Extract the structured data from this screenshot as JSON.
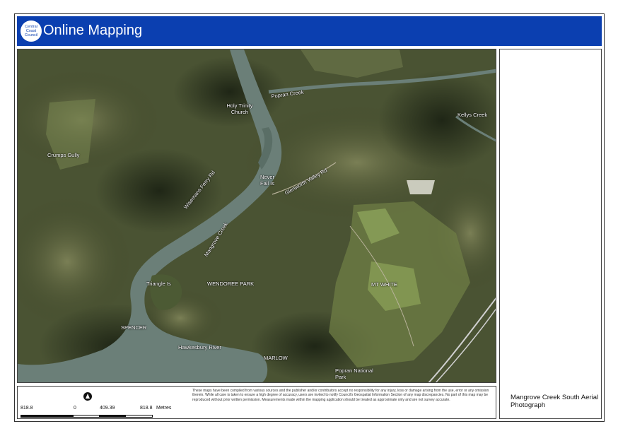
{
  "header": {
    "title": "Online Mapping",
    "logo_text": "Central Coast Council",
    "color": "#0b3fb0"
  },
  "map": {
    "labels": [
      {
        "id": "holy-trinity-church",
        "text": "Holy Trinity Church"
      },
      {
        "id": "popran-creek",
        "text": "Popran Creek"
      },
      {
        "id": "kellys-creek",
        "text": "Kellys Creek"
      },
      {
        "id": "crumps-gully",
        "text": "Crumps Gully"
      },
      {
        "id": "never-fail-is",
        "text": "Never Fail Is"
      },
      {
        "id": "glenworth-valley-rd",
        "text": "Glenworth Valley Rd"
      },
      {
        "id": "wisemans-ferry-rd",
        "text": "Wisemans Ferry Rd"
      },
      {
        "id": "mangrove-creek",
        "text": "Mangrove Creek"
      },
      {
        "id": "triangle-is",
        "text": "Triangle Is"
      },
      {
        "id": "wendoree-park",
        "text": "WENDOREE PARK"
      },
      {
        "id": "mt-white",
        "text": "MT WHITE"
      },
      {
        "id": "spencer",
        "text": "SPENCER"
      },
      {
        "id": "hawkesbury-river",
        "text": "Hawkesbury River"
      },
      {
        "id": "marlow",
        "text": "MARLOW"
      },
      {
        "id": "popran-national-park",
        "text": "Popran National Park"
      }
    ]
  },
  "legend": {
    "north_icon": "north-arrow-icon",
    "scale_ticks": [
      "818.8",
      "0",
      "409.39",
      "818.8"
    ],
    "scale_unit": "Metres",
    "disclaimer": "These maps have been compiled from various sources and the publisher and/or contributors accept no responsibility for any injury, loss or damage arising from the use, error or any omission therein. While all care is taken to ensure a high degree of accuracy, users are invited to notify Council's Geospatial Information Section of any map discrepancies. No part of this map may be reproduced without prior written permission. Measurements made within the mapping application should be treated as approximate only and are not survey accurate."
  },
  "side_panel": {
    "map_title": "Mangrove Creek South Aerial Photograph"
  }
}
